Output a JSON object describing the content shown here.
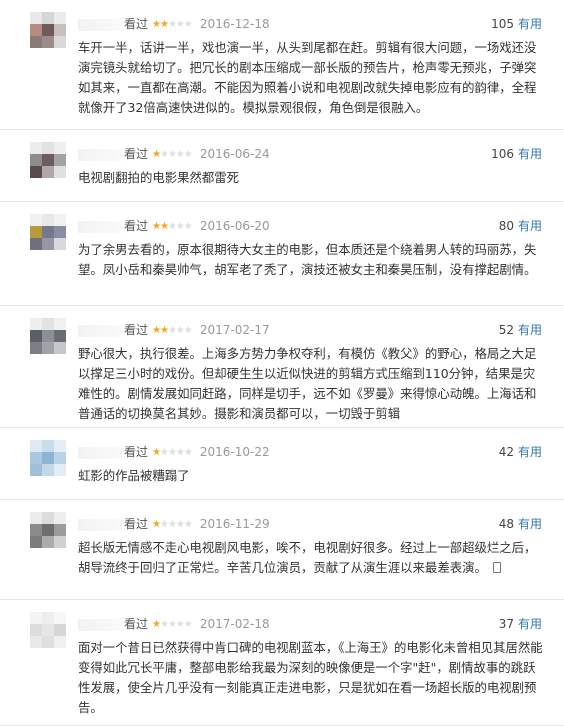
{
  "ui": {
    "useful_label": "有用",
    "status_label": "看过",
    "max_stars": 5
  },
  "reviews": [
    {
      "rating": 2,
      "date": "2016-12-18",
      "votes": "105",
      "text": "车开一半，话讲一半，戏也演一半，从头到尾都在赶。剪辑有很大问题，一场戏还没演完镜头就给切了。把冗长的剧本压缩成一部长版的预告片，枪声零无预兆，子弹突如其来，一直都在高潮。不能因为照着小说和电视剧改就失掉电影应有的韵律，全程就像开了32倍高速快进似的。模拟景观很假，角色倒是很融入。"
    },
    {
      "rating": 1,
      "date": "2016-06-24",
      "votes": "106",
      "text": "电视剧翻拍的电影果然都雷死"
    },
    {
      "rating": 2,
      "date": "2016-06-20",
      "votes": "80",
      "text": "为了余男去看的，原本很期待大女主的电影，但本质还是个绕着男人转的玛丽苏，失望。凤小岳和秦昊帅气，胡军老了秃了，演技还被女主和秦昊压制，没有撑起剧情。"
    },
    {
      "rating": 2,
      "date": "2017-02-17",
      "votes": "52",
      "text": "野心很大，执行很差。上海多方势力争权夺利，有模仿《教父》的野心，格局之大足以撑足三小时的戏份。但却硬生生以近似快进的剪辑方式压缩到110分钟，结果是灾难性的。剧情发展如同赶路，同样是切手，远不如《罗曼》来得惊心动魄。上海话和普通话的切换莫名其妙。摄影和演员都可以，一切毁于剪辑"
    },
    {
      "rating": 1,
      "date": "2016-10-22",
      "votes": "42",
      "text": "虹影的作品被糟蹋了"
    },
    {
      "rating": 1,
      "date": "2016-11-29",
      "votes": "48",
      "text": "超长版无情感不走心电视剧风电影，唉不，电视剧好很多。经过上一部超级烂之后，胡导流终于回归了正常烂。辛苦几位演员，贡献了从演生涯以来最差表演。"
    },
    {
      "rating": 1,
      "date": "2017-02-18",
      "votes": "37",
      "text": "面对一个昔日已然获得中肯口碑的电视剧蓝本，《上海王》的电影化未曾相见其居然能变得如此冗长平庸，整部电影给我最为深刻的映像便是一个字\"赶\"，剧情故事的跳跃性发展，使全片几乎没有一刻能真正走进电影，只是犹如在看一场超长版的电视剧预告。"
    }
  ]
}
